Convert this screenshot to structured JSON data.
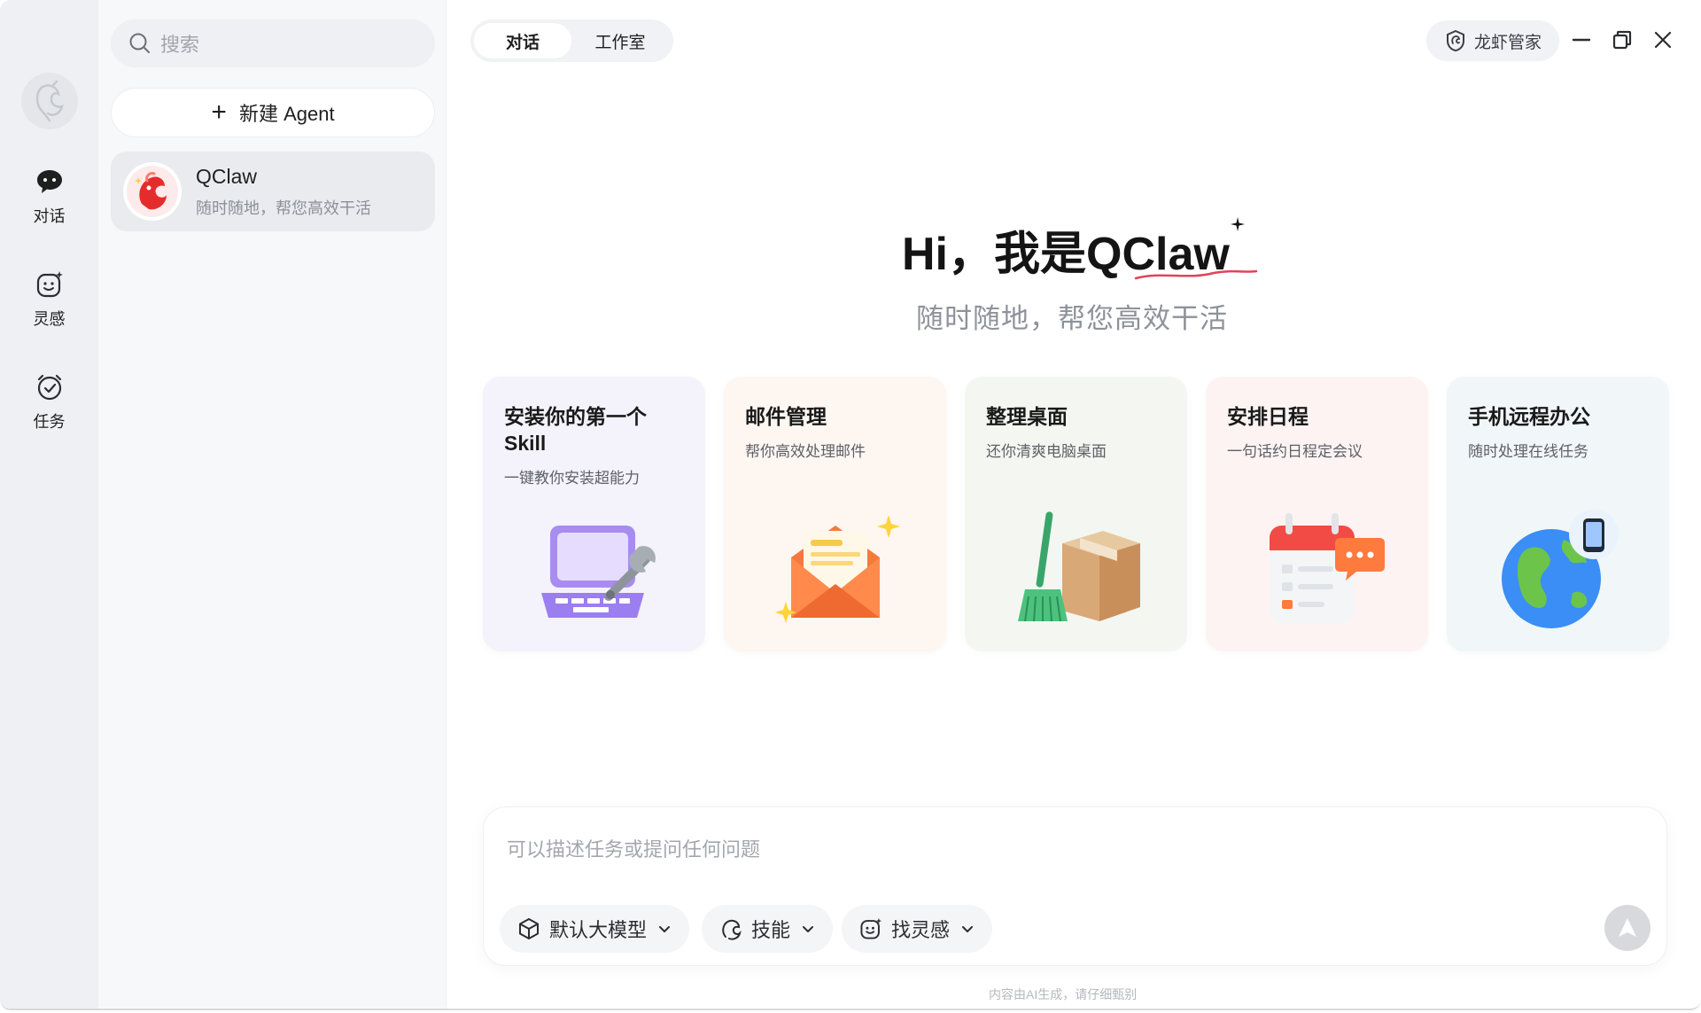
{
  "rail": {
    "items": [
      {
        "label": "对话",
        "icon": "chat-bubble-icon"
      },
      {
        "label": "灵感",
        "icon": "smile-sparkle-icon"
      },
      {
        "label": "任务",
        "icon": "alarm-check-icon"
      }
    ]
  },
  "sidebar": {
    "search_placeholder": "搜索",
    "new_agent_label": "新建 Agent",
    "agents": [
      {
        "name": "QClaw",
        "subtitle": "随时随地，帮您高效干活"
      }
    ]
  },
  "topbar": {
    "tabs": [
      {
        "label": "对话",
        "active": true
      },
      {
        "label": "工作室",
        "active": false
      }
    ],
    "manager_label": "龙虾管家"
  },
  "hero": {
    "title_prefix": "Hi，我是",
    "title_name": "QClaw",
    "subtitle": "随时随地，帮您高效干活"
  },
  "cards": [
    {
      "title": "安装你的第一个Skill",
      "subtitle": "一键教你安装超能力",
      "icon": "laptop-wrench-icon",
      "bg": "#f4f2fb"
    },
    {
      "title": "邮件管理",
      "subtitle": "帮你高效处理邮件",
      "icon": "envelope-icon",
      "bg": "#fdf6f1"
    },
    {
      "title": "整理桌面",
      "subtitle": "还你清爽电脑桌面",
      "icon": "box-broom-icon",
      "bg": "#f4f7f1"
    },
    {
      "title": "安排日程",
      "subtitle": "一句话约日程定会议",
      "icon": "calendar-icon",
      "bg": "#fdf3f3"
    },
    {
      "title": "手机远程办公",
      "subtitle": "随时处理在线任务",
      "icon": "globe-phone-icon",
      "bg": "#f1f6f8"
    }
  ],
  "composer": {
    "placeholder": "可以描述任务或提问任何问题",
    "model_label": "默认大模型",
    "skills_label": "技能",
    "inspiration_label": "找灵感"
  },
  "footer": {
    "disclaimer": "内容由AI生成，请仔细甄别"
  }
}
